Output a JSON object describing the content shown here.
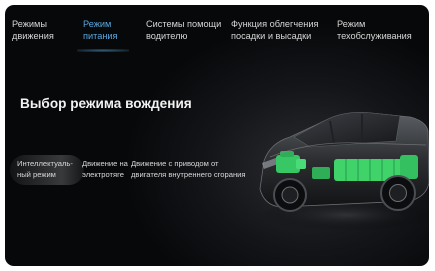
{
  "nav": {
    "tabs": [
      {
        "line1": "Режимы",
        "line2": "движения",
        "active": false
      },
      {
        "line1": "Режим",
        "line2": "питания",
        "active": true
      },
      {
        "line1": "Системы помощи",
        "line2": "водителю",
        "active": false
      },
      {
        "line1": "Функция облегчения",
        "line2": "посадки и высадки",
        "active": false
      },
      {
        "line1": "Режим",
        "line2": "техобслуживания",
        "active": false
      }
    ]
  },
  "main": {
    "title": "Выбор режима вождения",
    "modes": [
      {
        "line1": "Интеллектуаль-",
        "line2": "ный режим",
        "selected": true
      },
      {
        "line1": "Движение на",
        "line2": "электротяге",
        "selected": false
      },
      {
        "line1": "Движение с приводом от",
        "line2": "двигателя внутреннего сгорания",
        "selected": false
      }
    ]
  },
  "colors": {
    "accent": "#5aa7dc",
    "highlight_green": "#3fd36a",
    "background": "#07080a"
  },
  "icons": {
    "car_illustration": "car-xray-icon"
  }
}
